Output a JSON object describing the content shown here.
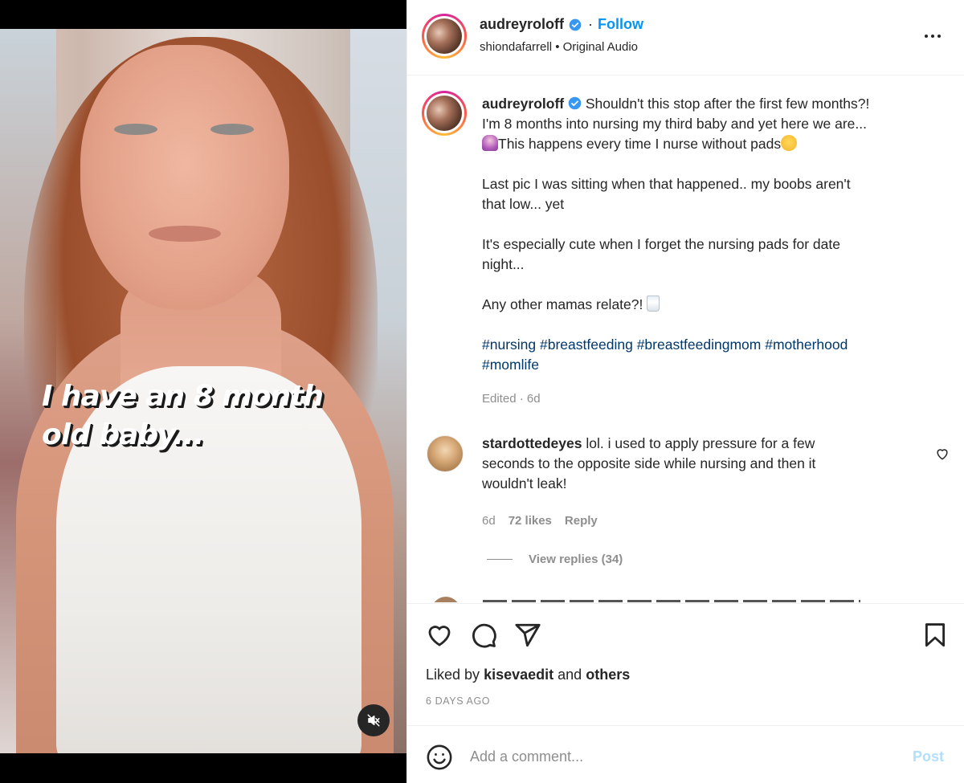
{
  "media": {
    "overlay_line1": "I have an 8 month",
    "overlay_line2": "old baby...",
    "mute_icon": "speaker-muted-icon"
  },
  "header": {
    "username": "audreyroloff",
    "separator": "·",
    "follow_label": "Follow",
    "audio_line": "shiondafarrell • Original Audio",
    "more_icon": "more-horizontal-icon"
  },
  "caption": {
    "username": "audreyroloff",
    "line1": "Shouldn't this stop after the first few months?!",
    "line2": "I'm 8 months into nursing my third baby and yet here we are...",
    "line3": "This happens every time I nurse without pads",
    "para2_line1": "Last pic I was sitting when that happened.. my boobs aren't",
    "para2_line2": "that low... yet",
    "para3_line1": "It's especially cute when I forget the nursing pads for date",
    "para3_line2": "night...",
    "para4": "Any other mamas relate?!",
    "hashtags": [
      "#nursing",
      "#breastfeeding",
      "#breastfeedingmom",
      "#motherhood",
      "#momlife"
    ],
    "edited": "Edited · 6d"
  },
  "comment": {
    "username": "stardottedeyes",
    "text_line1": "lol. i used to apply pressure for a few",
    "text_line2": "seconds to the opposite side while nursing and then it",
    "text_line3": "wouldn't leak!",
    "time": "6d",
    "likes": "72 likes",
    "reply_label": "Reply",
    "view_replies": "View replies (34)"
  },
  "actions": {
    "liked_by_prefix": "Liked by",
    "liked_by_user": "kisevaedit",
    "liked_by_and": "and",
    "liked_by_others": "others",
    "date": "6 DAYS AGO"
  },
  "add_comment": {
    "placeholder": "Add a comment...",
    "post_label": "Post"
  },
  "colors": {
    "link_blue": "#0095f6",
    "hashtag": "#00376b",
    "muted_text": "#8e8e8e",
    "post_disabled": "#b2dffc"
  }
}
